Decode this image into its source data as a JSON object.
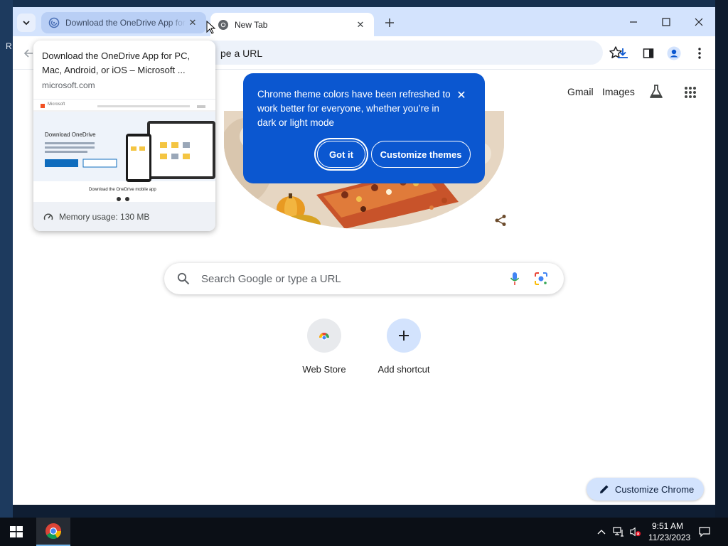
{
  "desktop": {
    "left_glyph": "R"
  },
  "tabs": [
    {
      "title": "Download the OneDrive App for PC, Mac, Android, or iOS – Microsoft",
      "close": "✕",
      "favicon": "onedrive-loading-icon"
    },
    {
      "title": "New Tab",
      "close": "✕",
      "favicon": "chrome-icon"
    }
  ],
  "window_controls": {
    "minimize": "—",
    "maximize": "☐",
    "close": "✕"
  },
  "omnibox": {
    "text": "pe a URL"
  },
  "ntp": {
    "links": {
      "gmail": "Gmail",
      "images": "Images"
    },
    "search_placeholder": "Search Google or type a URL",
    "shortcuts": [
      {
        "label": "Web Store",
        "icon": "web-store-icon"
      },
      {
        "label": "Add shortcut",
        "icon": "plus-icon"
      }
    ],
    "customize_chrome": "Customize Chrome"
  },
  "tab_hover_card": {
    "title": "Download the OneDrive App for PC, Mac, Android, or iOS – Microsoft ...",
    "domain": "microsoft.com",
    "preview": {
      "brand": "Microsoft",
      "heading": "Download OneDrive",
      "subheading": "Download the OneDrive mobile app"
    },
    "memory": "Memory usage: 130 MB"
  },
  "theme_promo": {
    "message": "Chrome theme colors have been refreshed to work better for everyone, whether you’re in dark or light mode",
    "got_it": "Got it",
    "customize": "Customize themes",
    "close": "✕"
  },
  "taskbar": {
    "time": "9:51 AM",
    "date": "11/23/2023"
  },
  "colors": {
    "accent": "#0b57d0",
    "tabstrip": "#d3e3fd",
    "omnibox": "#edf2fa",
    "taskbar": "#0b0f16"
  }
}
